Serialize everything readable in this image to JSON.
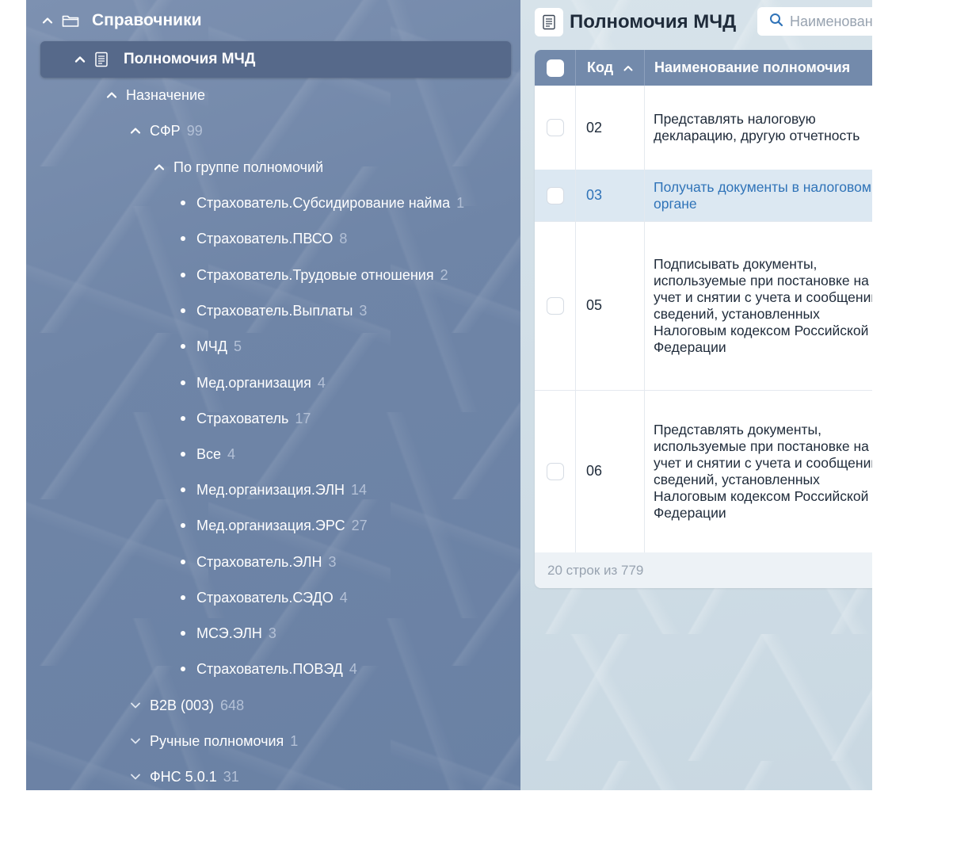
{
  "sidebar": {
    "root": {
      "label": "Справочники",
      "icon": "folder-icon",
      "expanded": true
    },
    "selected": {
      "label": "Полномочия МЧД",
      "icon": "document-icon",
      "expanded": true
    },
    "nodes": {
      "assignment": {
        "label": "Назначение",
        "expanded": true
      },
      "sfr": {
        "label": "СФР",
        "count": "99",
        "expanded": true
      },
      "by_group": {
        "label": "По группе полномочий",
        "expanded": true
      }
    },
    "groups": [
      {
        "label": "Страхователь.Субсидирование найма",
        "count": "1"
      },
      {
        "label": "Страхователь.ПВСО",
        "count": "8"
      },
      {
        "label": "Страхователь.Трудовые отношения",
        "count": "2"
      },
      {
        "label": "Страхователь.Выплаты",
        "count": "3"
      },
      {
        "label": "МЧД",
        "count": "5"
      },
      {
        "label": "Мед.организация",
        "count": "4"
      },
      {
        "label": "Страхователь",
        "count": "17"
      },
      {
        "label": "Все",
        "count": "4"
      },
      {
        "label": "Мед.организация.ЭЛН",
        "count": "14"
      },
      {
        "label": "Мед.организация.ЭРС",
        "count": "27"
      },
      {
        "label": "Страхователь.ЭЛН",
        "count": "3"
      },
      {
        "label": "Страхователь.СЭДО",
        "count": "4"
      },
      {
        "label": "МСЭ.ЭЛН",
        "count": "3"
      },
      {
        "label": "Страхователь.ПОВЭД",
        "count": "4"
      }
    ],
    "collapsed": [
      {
        "label": "B2B (003)",
        "count": "648"
      },
      {
        "label": "Ручные полномочия",
        "count": "1"
      },
      {
        "label": "ФНС 5.0.1",
        "count": "31"
      }
    ]
  },
  "main": {
    "title": "Полномочия МЧД",
    "title_icon": "document-icon",
    "search": {
      "placeholder": "Наименование",
      "value": "",
      "icon": "search-icon"
    },
    "table": {
      "columns": {
        "code": "Код",
        "name": "Наименование полномочия"
      },
      "sort": {
        "column": "code",
        "direction": "asc"
      },
      "rows": [
        {
          "code": "02",
          "name": "Представлять налоговую декларацию, другую отчетность",
          "highlighted": false
        },
        {
          "code": "03",
          "name": "Получать документы в налоговом органе",
          "highlighted": true
        },
        {
          "code": "05",
          "name": "Подписывать документы, используемые при постановке на учет и снятии с учета и сообщении сведений, установленных Налоговым кодексом Российской Федерации",
          "highlighted": false
        },
        {
          "code": "06",
          "name": "Представлять документы, используемые при постановке на учет и снятии с учета и сообщении сведений, установленных Налоговым кодексом Российской Федерации",
          "highlighted": false
        }
      ],
      "footer": "20 строк из 779"
    }
  },
  "colors": {
    "sidebar_bg": "#6f85a7",
    "sidebar_selected": "#56698a",
    "table_header": "#738aab",
    "highlight_row": "#dce8f2",
    "link_text": "#2f73b8",
    "count_text": "#b3c0d6"
  }
}
